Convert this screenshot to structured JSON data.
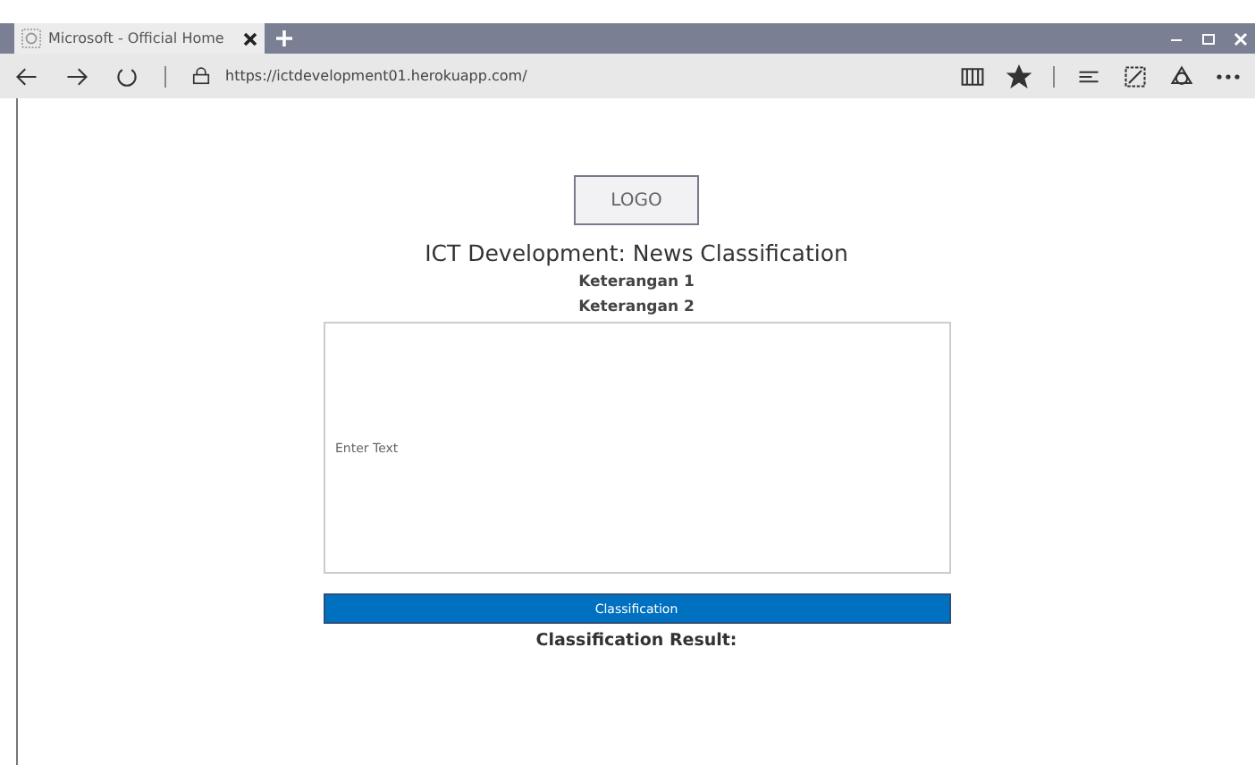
{
  "browser": {
    "tabs": [
      {
        "title": "Microsoft - Official Home",
        "selected": true
      }
    ],
    "address": "https://ictdevelopment01.herokuapp.com/"
  },
  "page": {
    "logo": "LOGO",
    "title": "ICT Development: News Classification",
    "captions": [
      "Keterangan 1",
      "Keterangan 2"
    ],
    "text_field": {
      "placeholder": "Enter Text"
    },
    "button": "Classification",
    "result_label": "Classification Result:"
  }
}
